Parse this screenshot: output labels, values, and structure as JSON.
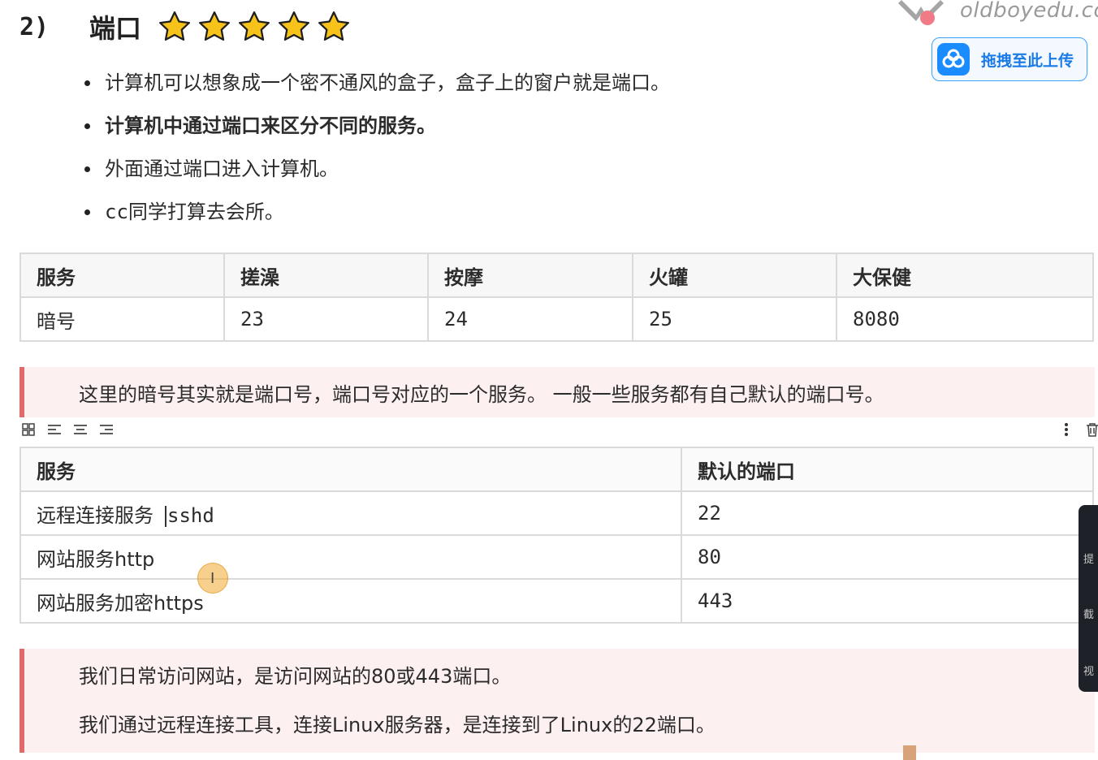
{
  "heading": {
    "number": "2)",
    "title": "端口",
    "star_count": 5,
    "star_color": "#f5b400"
  },
  "watermark": {
    "text": "oldboyedu.co"
  },
  "upload_button": {
    "label": "拖拽至此上传",
    "icon": "cloud-icon",
    "color": "#1a8cff"
  },
  "bullets": [
    "计算机可以想象成一个密不通风的盒子，盒子上的窗户就是端口。",
    "计算机中通过端口来区分不同的服务。",
    "外面通过端口进入计算机。",
    "cc同学打算去会所。"
  ],
  "table1": {
    "headers": [
      "服务",
      "搓澡",
      "按摩",
      "火罐",
      "大保健"
    ],
    "row_label": "暗号",
    "values": [
      "23",
      "24",
      "25",
      "8080"
    ]
  },
  "callout1": {
    "text": "这里的暗号其实就是端口号，端口号对应的一个服务。  一般一些服务都有自己默认的端口号。",
    "border_color": "#e06a6a"
  },
  "toolbar": {
    "left_icons": [
      "grid-icon",
      "align-left-icon",
      "align-center-icon",
      "align-right-icon"
    ],
    "right_icons": [
      "more-icon",
      "trash-icon"
    ]
  },
  "table2": {
    "headers": [
      "服务",
      "默认的端口"
    ],
    "rows": [
      {
        "service_a": "远程连接服务",
        "service_b": "sshd",
        "port": "22"
      },
      {
        "service": "网站服务http",
        "port": "80"
      },
      {
        "service": "网站服务加密https",
        "port": "443"
      }
    ]
  },
  "callout2": {
    "lines": [
      "我们日常访问网站，是访问网站的80或443端口。",
      "我们通过远程连接工具，连接Linux服务器，是连接到了Linux的22端口。"
    ]
  },
  "side_panel": {
    "labels": [
      "提",
      "截",
      "视"
    ]
  }
}
